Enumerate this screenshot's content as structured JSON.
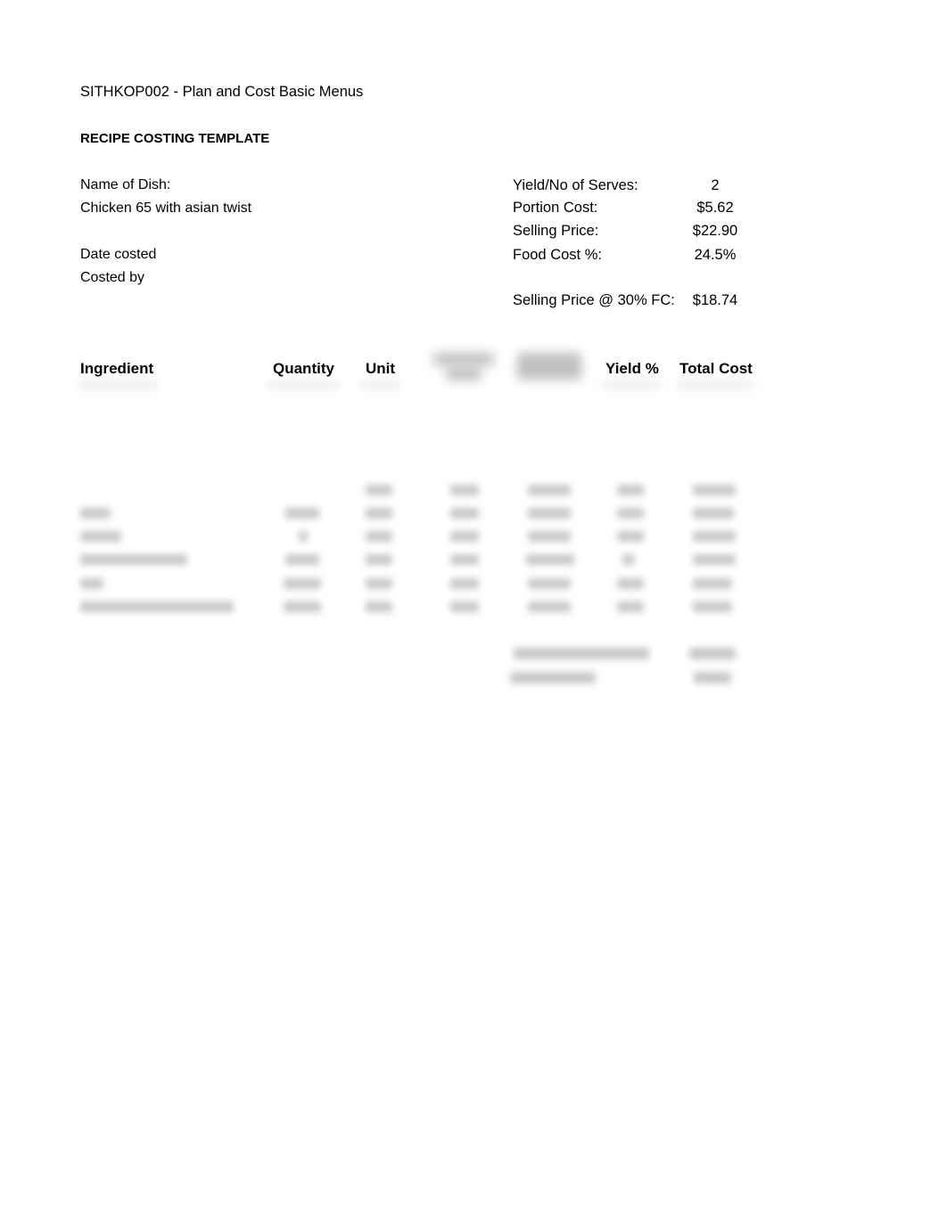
{
  "document": {
    "course_title": "SITHKOP002 - Plan and Cost Basic Menus",
    "template_title": "RECIPE COSTING TEMPLATE"
  },
  "dish_info": {
    "name_label": "Name of Dish:",
    "name_value": "Chicken 65 with asian twist",
    "date_costed_label": "Date costed",
    "costed_by_label": "Costed by"
  },
  "summary": {
    "yield_label": "Yield/No of Serves:",
    "yield_value": "2",
    "portion_cost_label": "Portion Cost:",
    "portion_cost_value": "$5.62",
    "selling_price_label": "Selling Price:",
    "selling_price_value": "$22.90",
    "food_cost_label": "Food Cost %:",
    "food_cost_value": "24.5%",
    "selling_price_30_label": "Selling Price @ 30% FC:",
    "selling_price_30_value": "$18.74"
  },
  "table": {
    "headers": {
      "ingredient": "Ingredient",
      "quantity": "Quantity",
      "unit": "Unit",
      "yield": "Yield %",
      "total_cost": "Total Cost"
    },
    "blurred_columns": 2,
    "blurred_rows": 6,
    "blurred_totals_rows": 2
  }
}
